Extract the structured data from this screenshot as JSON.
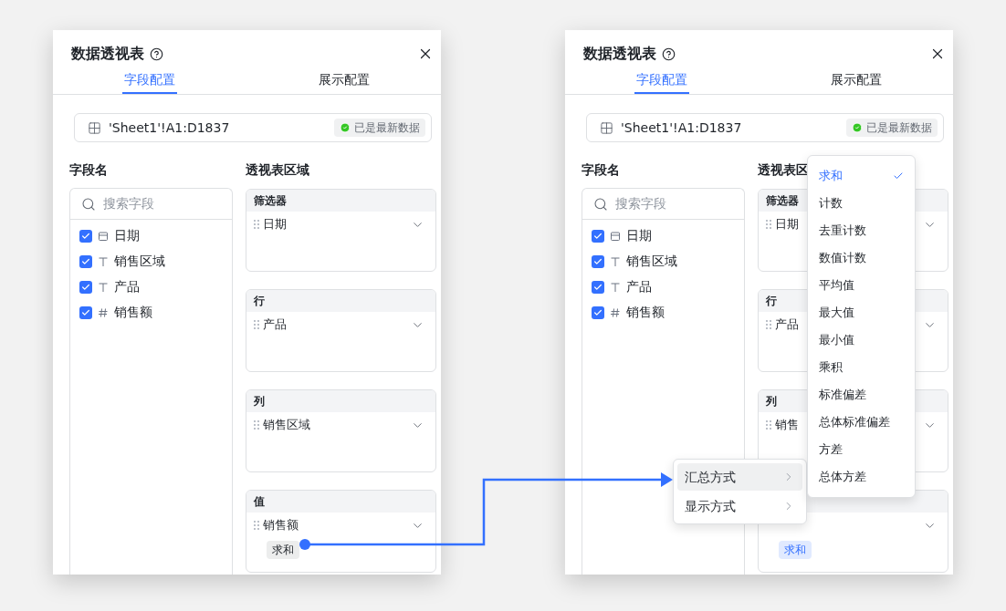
{
  "panels": [
    {
      "title": "数据透视表",
      "tabs": [
        {
          "label": "字段配置",
          "selected": true
        },
        {
          "label": "展示配置",
          "selected": false
        }
      ],
      "source": {
        "range": "'Sheet1'!A1:D1837",
        "status": "已是最新数据"
      },
      "fields_heading": "字段名",
      "search": {
        "placeholder": "搜索字段"
      },
      "fields": [
        {
          "name": "日期",
          "kind": "date",
          "checked": true
        },
        {
          "name": "销售区域",
          "kind": "text",
          "checked": true
        },
        {
          "name": "产品",
          "kind": "text",
          "checked": true
        },
        {
          "name": "销售额",
          "kind": "number",
          "checked": true
        }
      ],
      "zones_heading": "透视表区域",
      "zones": [
        {
          "header": "筛选器",
          "field": "日期"
        },
        {
          "header": "行",
          "field": "产品"
        },
        {
          "header": "列",
          "field": "销售区域"
        },
        {
          "header": "值",
          "field": "销售额",
          "tag": {
            "label": "求和",
            "selected": false
          }
        }
      ]
    },
    {
      "title": "数据透视表",
      "tabs": [
        {
          "label": "字段配置",
          "selected": true
        },
        {
          "label": "展示配置",
          "selected": false
        }
      ],
      "source": {
        "range": "'Sheet1'!A1:D1837",
        "status": "已是最新数据"
      },
      "fields_heading": "字段名",
      "search": {
        "placeholder": "搜索字段"
      },
      "fields": [
        {
          "name": "日期",
          "kind": "date",
          "checked": true
        },
        {
          "name": "销售区域",
          "kind": "text",
          "checked": true
        },
        {
          "name": "产品",
          "kind": "text",
          "checked": true
        },
        {
          "name": "销售额",
          "kind": "number",
          "checked": true
        }
      ],
      "zones_heading": "透视表区",
      "zones": [
        {
          "header": "筛选器",
          "field": "日期"
        },
        {
          "header": "行",
          "field": "产品"
        },
        {
          "header": "列",
          "field": "销售"
        },
        {
          "tag": {
            "label": "求和",
            "selected": true
          }
        }
      ],
      "context_menu": [
        {
          "label": "汇总方式",
          "selected": true
        },
        {
          "label": "显示方式",
          "selected": false
        }
      ],
      "dropdown": [
        {
          "label": "求和",
          "selected": true
        },
        {
          "label": "计数",
          "selected": false
        },
        {
          "label": "去重计数",
          "selected": false
        },
        {
          "label": "数值计数",
          "selected": false
        },
        {
          "label": "平均值",
          "selected": false
        },
        {
          "label": "最大值",
          "selected": false
        },
        {
          "label": "最小值",
          "selected": false
        },
        {
          "label": "乘积",
          "selected": false
        },
        {
          "label": "标准偏差",
          "selected": false
        },
        {
          "label": "总体标准偏差",
          "selected": false
        },
        {
          "label": "方差",
          "selected": false
        },
        {
          "label": "总体方差",
          "selected": false
        }
      ]
    }
  ]
}
